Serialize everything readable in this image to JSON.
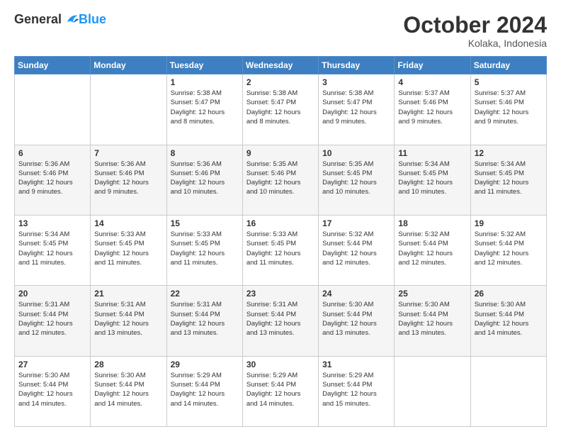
{
  "header": {
    "logo": {
      "general": "General",
      "blue": "Blue"
    },
    "title": "October 2024",
    "location": "Kolaka, Indonesia"
  },
  "days_of_week": [
    "Sunday",
    "Monday",
    "Tuesday",
    "Wednesday",
    "Thursday",
    "Friday",
    "Saturday"
  ],
  "weeks": [
    [
      null,
      null,
      {
        "day": 1,
        "sunrise": "5:38 AM",
        "sunset": "5:47 PM",
        "daylight": "12 hours and 8 minutes."
      },
      {
        "day": 2,
        "sunrise": "5:38 AM",
        "sunset": "5:47 PM",
        "daylight": "12 hours and 8 minutes."
      },
      {
        "day": 3,
        "sunrise": "5:38 AM",
        "sunset": "5:47 PM",
        "daylight": "12 hours and 9 minutes."
      },
      {
        "day": 4,
        "sunrise": "5:37 AM",
        "sunset": "5:46 PM",
        "daylight": "12 hours and 9 minutes."
      },
      {
        "day": 5,
        "sunrise": "5:37 AM",
        "sunset": "5:46 PM",
        "daylight": "12 hours and 9 minutes."
      }
    ],
    [
      {
        "day": 6,
        "sunrise": "5:36 AM",
        "sunset": "5:46 PM",
        "daylight": "12 hours and 9 minutes."
      },
      {
        "day": 7,
        "sunrise": "5:36 AM",
        "sunset": "5:46 PM",
        "daylight": "12 hours and 9 minutes."
      },
      {
        "day": 8,
        "sunrise": "5:36 AM",
        "sunset": "5:46 PM",
        "daylight": "12 hours and 10 minutes."
      },
      {
        "day": 9,
        "sunrise": "5:35 AM",
        "sunset": "5:46 PM",
        "daylight": "12 hours and 10 minutes."
      },
      {
        "day": 10,
        "sunrise": "5:35 AM",
        "sunset": "5:45 PM",
        "daylight": "12 hours and 10 minutes."
      },
      {
        "day": 11,
        "sunrise": "5:34 AM",
        "sunset": "5:45 PM",
        "daylight": "12 hours and 10 minutes."
      },
      {
        "day": 12,
        "sunrise": "5:34 AM",
        "sunset": "5:45 PM",
        "daylight": "12 hours and 11 minutes."
      }
    ],
    [
      {
        "day": 13,
        "sunrise": "5:34 AM",
        "sunset": "5:45 PM",
        "daylight": "12 hours and 11 minutes."
      },
      {
        "day": 14,
        "sunrise": "5:33 AM",
        "sunset": "5:45 PM",
        "daylight": "12 hours and 11 minutes."
      },
      {
        "day": 15,
        "sunrise": "5:33 AM",
        "sunset": "5:45 PM",
        "daylight": "12 hours and 11 minutes."
      },
      {
        "day": 16,
        "sunrise": "5:33 AM",
        "sunset": "5:45 PM",
        "daylight": "12 hours and 11 minutes."
      },
      {
        "day": 17,
        "sunrise": "5:32 AM",
        "sunset": "5:44 PM",
        "daylight": "12 hours and 12 minutes."
      },
      {
        "day": 18,
        "sunrise": "5:32 AM",
        "sunset": "5:44 PM",
        "daylight": "12 hours and 12 minutes."
      },
      {
        "day": 19,
        "sunrise": "5:32 AM",
        "sunset": "5:44 PM",
        "daylight": "12 hours and 12 minutes."
      }
    ],
    [
      {
        "day": 20,
        "sunrise": "5:31 AM",
        "sunset": "5:44 PM",
        "daylight": "12 hours and 12 minutes."
      },
      {
        "day": 21,
        "sunrise": "5:31 AM",
        "sunset": "5:44 PM",
        "daylight": "12 hours and 13 minutes."
      },
      {
        "day": 22,
        "sunrise": "5:31 AM",
        "sunset": "5:44 PM",
        "daylight": "12 hours and 13 minutes."
      },
      {
        "day": 23,
        "sunrise": "5:31 AM",
        "sunset": "5:44 PM",
        "daylight": "12 hours and 13 minutes."
      },
      {
        "day": 24,
        "sunrise": "5:30 AM",
        "sunset": "5:44 PM",
        "daylight": "12 hours and 13 minutes."
      },
      {
        "day": 25,
        "sunrise": "5:30 AM",
        "sunset": "5:44 PM",
        "daylight": "12 hours and 13 minutes."
      },
      {
        "day": 26,
        "sunrise": "5:30 AM",
        "sunset": "5:44 PM",
        "daylight": "12 hours and 14 minutes."
      }
    ],
    [
      {
        "day": 27,
        "sunrise": "5:30 AM",
        "sunset": "5:44 PM",
        "daylight": "12 hours and 14 minutes."
      },
      {
        "day": 28,
        "sunrise": "5:30 AM",
        "sunset": "5:44 PM",
        "daylight": "12 hours and 14 minutes."
      },
      {
        "day": 29,
        "sunrise": "5:29 AM",
        "sunset": "5:44 PM",
        "daylight": "12 hours and 14 minutes."
      },
      {
        "day": 30,
        "sunrise": "5:29 AM",
        "sunset": "5:44 PM",
        "daylight": "12 hours and 14 minutes."
      },
      {
        "day": 31,
        "sunrise": "5:29 AM",
        "sunset": "5:44 PM",
        "daylight": "12 hours and 15 minutes."
      },
      null,
      null
    ]
  ]
}
